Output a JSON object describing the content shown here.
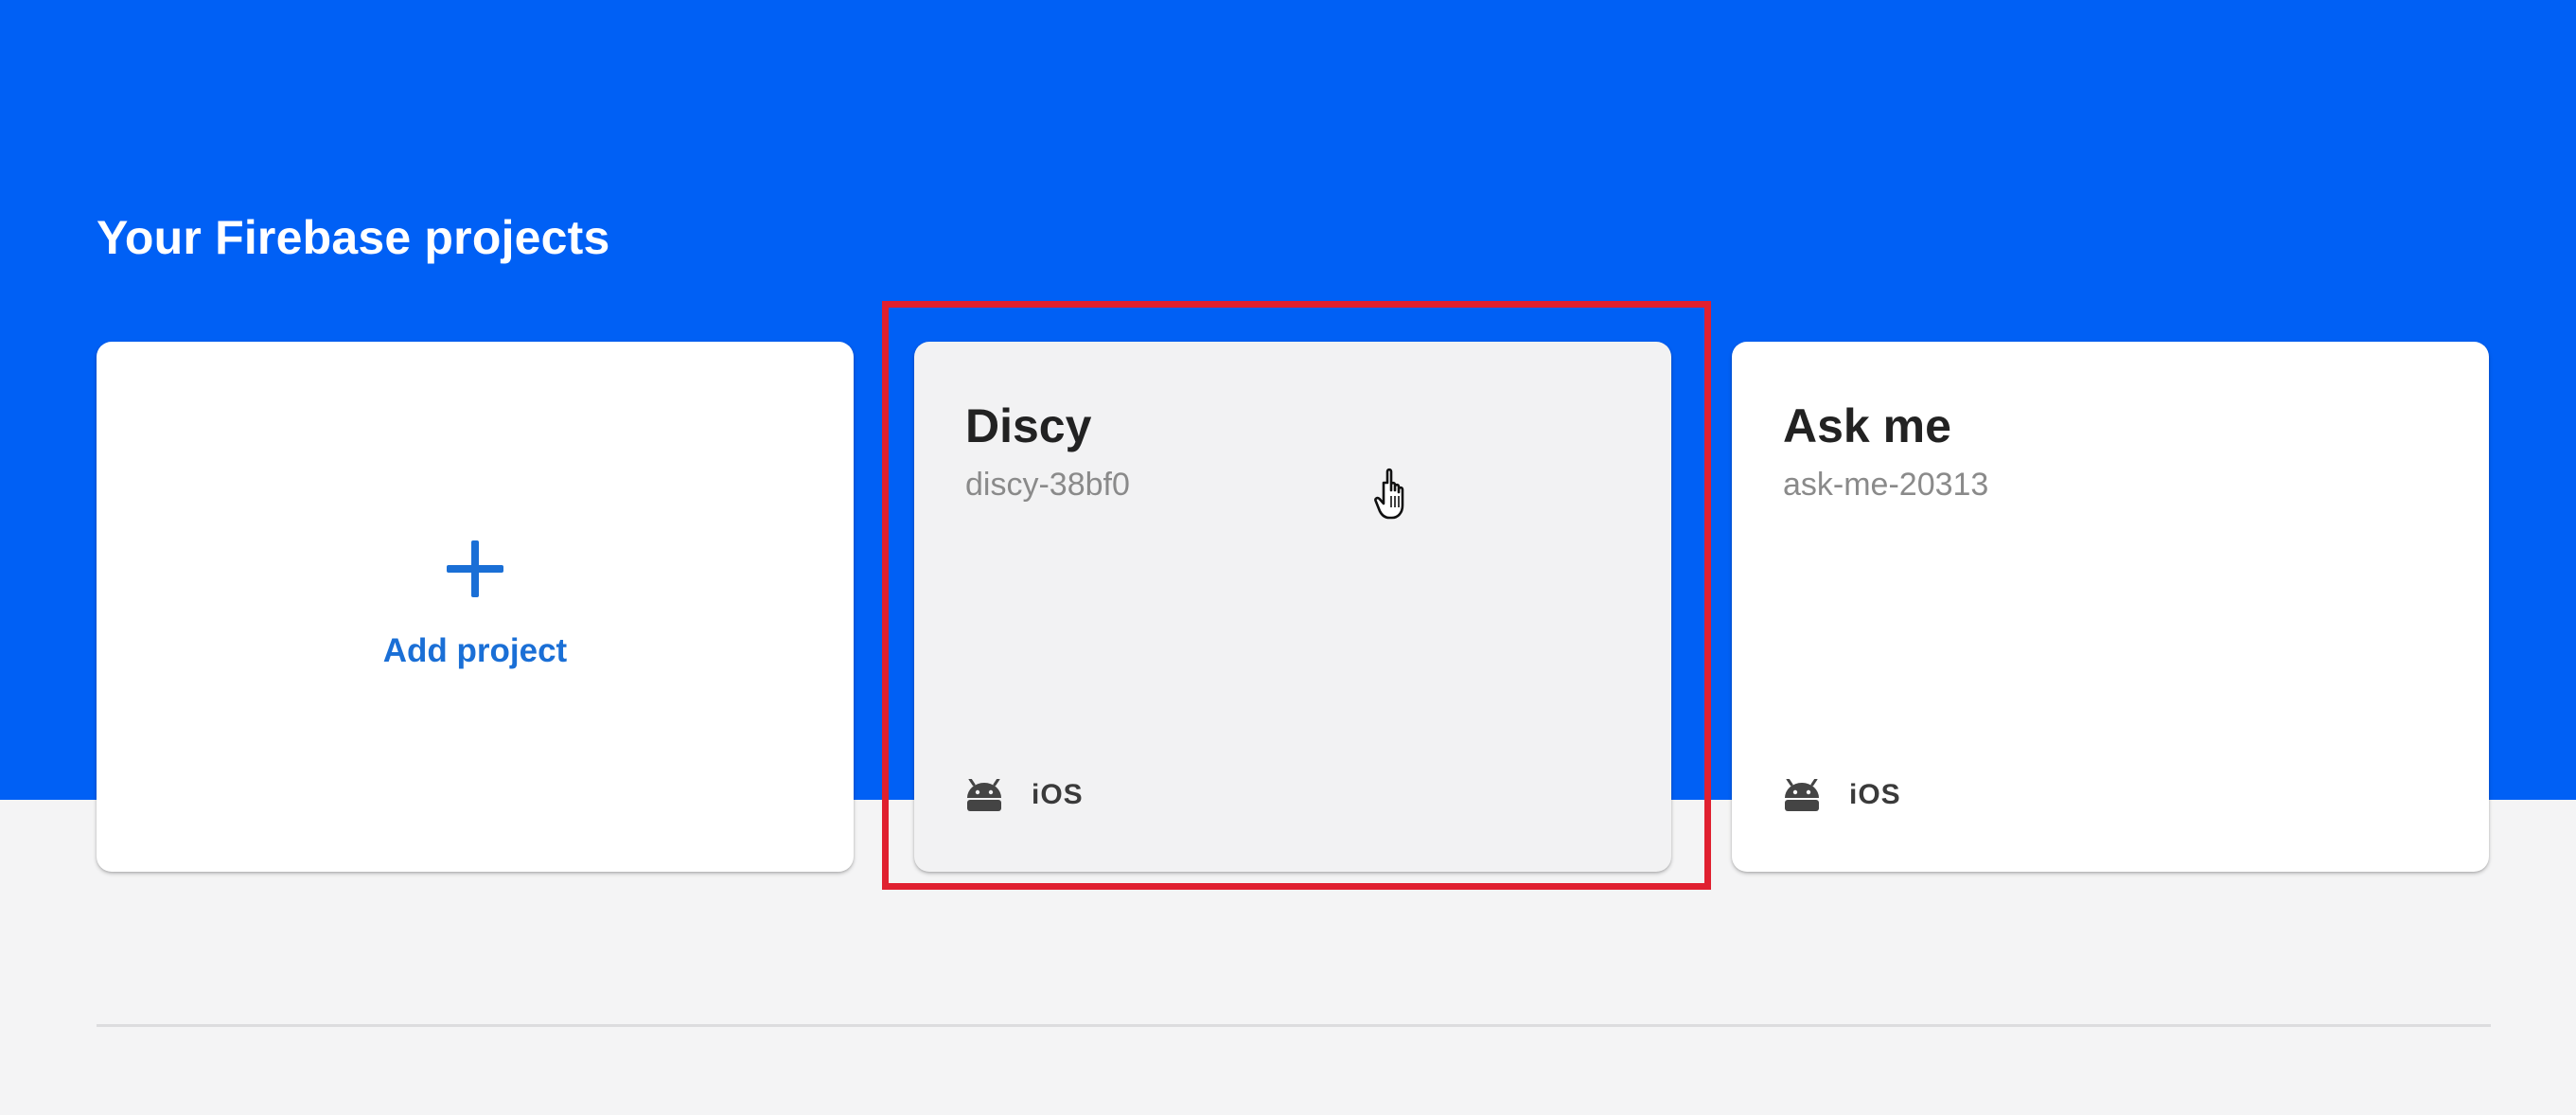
{
  "section": {
    "title": "Your Firebase projects"
  },
  "add_card": {
    "label": "Add project",
    "icon": "plus-icon"
  },
  "projects": [
    {
      "name": "Discy",
      "id": "discy-38bf0",
      "platforms": [
        "android",
        "iOS"
      ],
      "hovered": true,
      "highlighted": true
    },
    {
      "name": "Ask me",
      "id": "ask-me-20313",
      "platforms": [
        "android",
        "iOS"
      ],
      "hovered": false,
      "highlighted": false
    }
  ],
  "colors": {
    "hero": "#0060f5",
    "accent": "#1a6fd6",
    "highlight": "#e02030",
    "page_bg": "#f4f4f5"
  }
}
